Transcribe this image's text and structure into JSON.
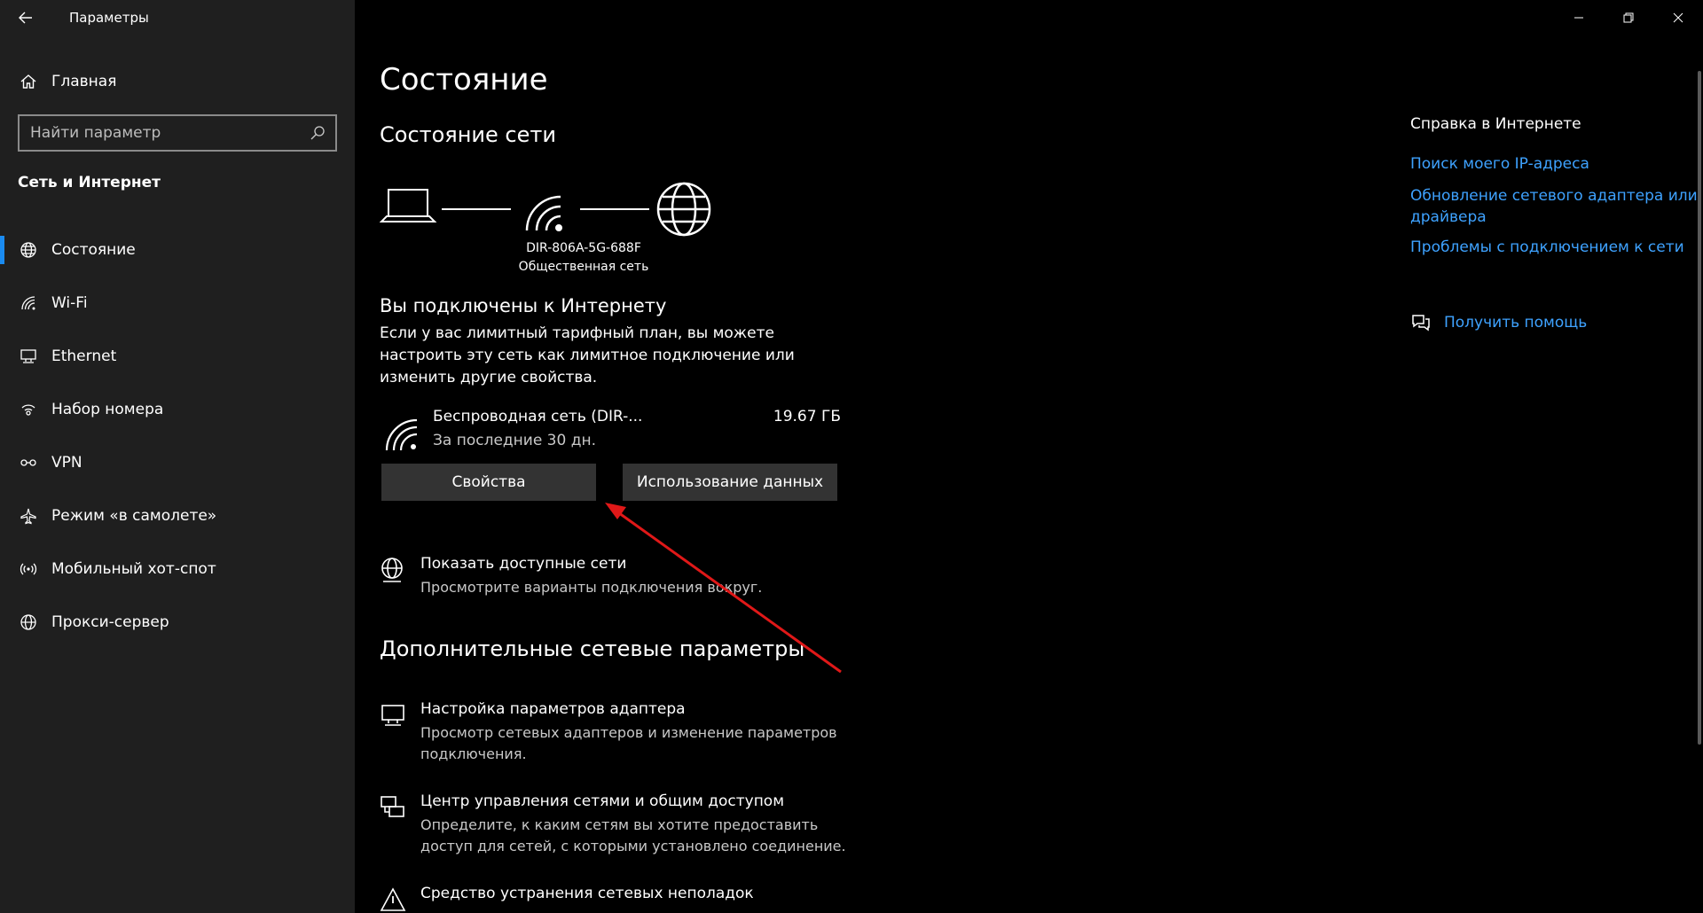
{
  "app": {
    "title": "Параметры"
  },
  "sidebar": {
    "home_label": "Главная",
    "search_placeholder": "Найти параметр",
    "section_label": "Сеть и Интернет",
    "items": [
      {
        "label": "Состояние",
        "icon": "globe-icon",
        "active": true
      },
      {
        "label": "Wi-Fi",
        "icon": "wifi-icon",
        "active": false
      },
      {
        "label": "Ethernet",
        "icon": "ethernet-icon",
        "active": false
      },
      {
        "label": "Набор номера",
        "icon": "dialup-icon",
        "active": false
      },
      {
        "label": "VPN",
        "icon": "vpn-icon",
        "active": false
      },
      {
        "label": "Режим «в самолете»",
        "icon": "airplane-icon",
        "active": false
      },
      {
        "label": "Мобильный хот-спот",
        "icon": "hotspot-icon",
        "active": false
      },
      {
        "label": "Прокси-сервер",
        "icon": "proxy-globe-icon",
        "active": false
      }
    ]
  },
  "main": {
    "title": "Состояние",
    "network_status_heading": "Состояние сети",
    "network_name": "DIR-806A-5G-688F",
    "network_type": "Общественная сеть",
    "connected_heading": "Вы подключены к Интернету",
    "connected_desc": "Если у вас лимитный тарифный план, вы можете настроить эту сеть как лимитное подключение или изменить другие свойства.",
    "connection": {
      "name": "Беспроводная сеть (DIR-...",
      "period": "За последние 30 дн.",
      "usage": "19.67 ГБ"
    },
    "properties_button": "Свойства",
    "data_usage_button": "Использование данных",
    "show_networks": {
      "title": "Показать доступные сети",
      "sub": "Просмотрите варианты подключения вокруг."
    },
    "advanced_heading": "Дополнительные сетевые параметры",
    "adapter_settings": {
      "title": "Настройка параметров адаптера",
      "sub": "Просмотр сетевых адаптеров и изменение параметров подключения."
    },
    "network_center": {
      "title": "Центр управления сетями и общим доступом",
      "sub": "Определите, к каким сетям вы хотите предоставить доступ для сетей, с которыми установлено соединение."
    },
    "troubleshooter": {
      "title": "Средство устранения сетевых неполадок"
    }
  },
  "right": {
    "help_heading": "Справка в Интернете",
    "links": [
      "Поиск моего IP-адреса",
      "Обновление сетевого адаптера или драйвера",
      "Проблемы с подключением к сети"
    ],
    "get_help": "Получить помощь"
  },
  "colors": {
    "accent": "#1a8bf0",
    "link": "#3ea2ff",
    "arrow": "#e01818"
  }
}
